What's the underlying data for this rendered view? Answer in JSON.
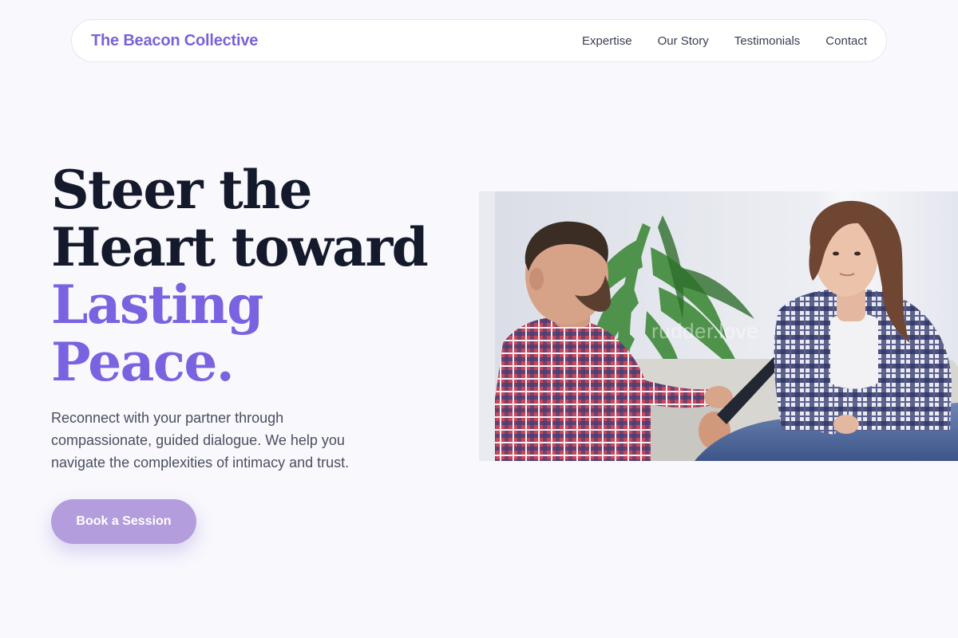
{
  "nav": {
    "brand": "The Beacon Collective",
    "links": [
      "Expertise",
      "Our Story",
      "Testimonials",
      "Contact"
    ]
  },
  "hero": {
    "title_lines": [
      "Steer the",
      "Heart toward"
    ],
    "title_accent_lines": [
      "Lasting",
      "Peace."
    ],
    "subtitle": "Reconnect with your partner through compassionate, guided dialogue. We help you navigate the complexities of intimacy and trust.",
    "cta_label": "Book a Session",
    "image_watermark": "rudder.love"
  },
  "colors": {
    "background": "#f8f8fd",
    "brand": "#7a63d6",
    "accent": "#7a62e0",
    "heading": "#141a2b",
    "cta": "#b39ddd"
  }
}
